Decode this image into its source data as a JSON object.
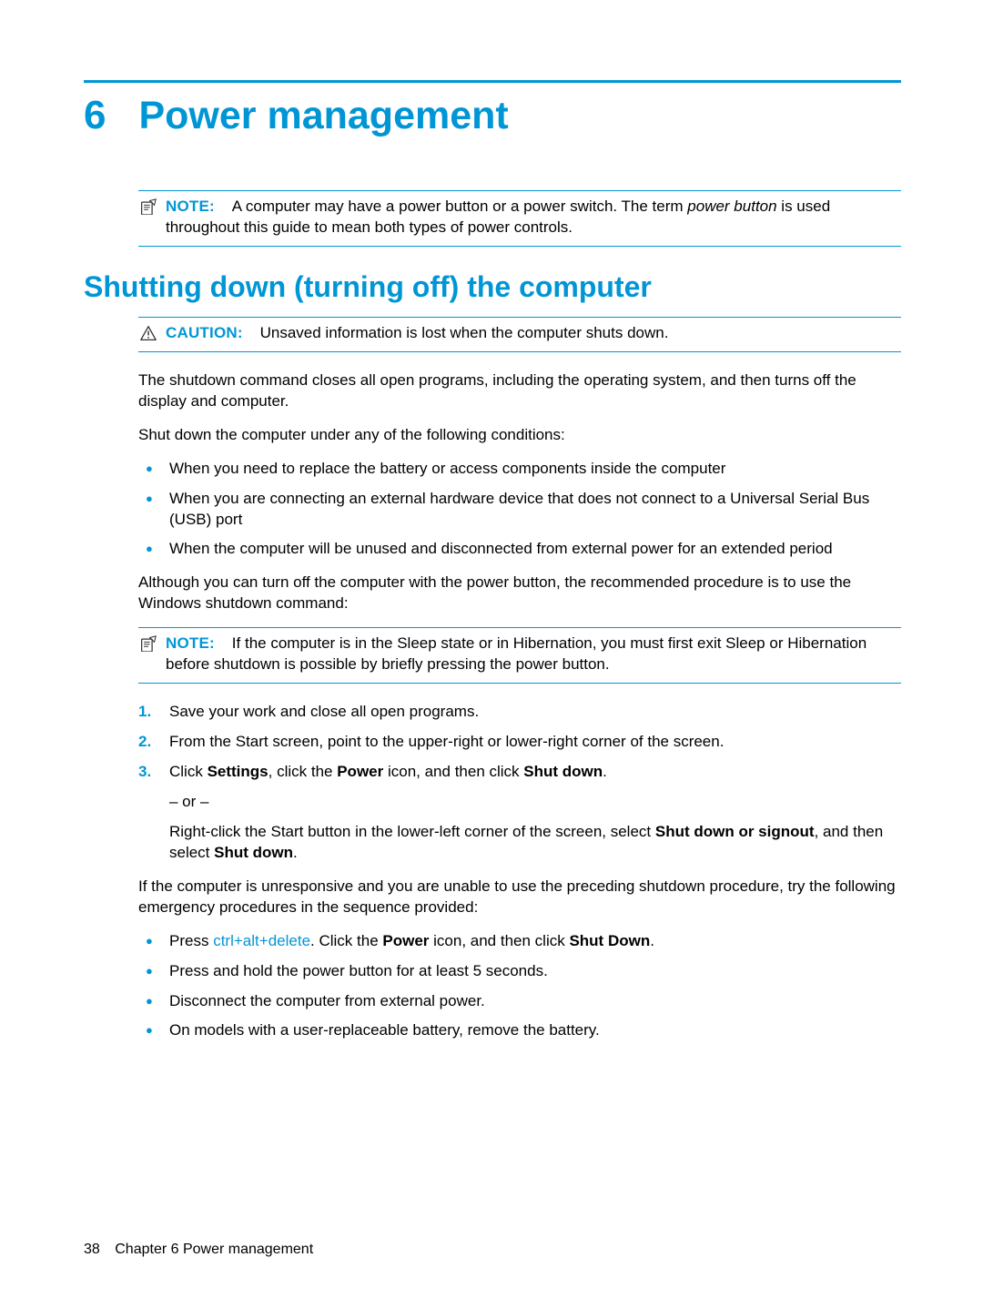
{
  "chapter": {
    "number": "6",
    "title": "Power management"
  },
  "note1": {
    "label": "NOTE:",
    "text_pre": "A computer may have a power button or a power switch. The term ",
    "text_em": "power button",
    "text_post": " is used throughout this guide to mean both types of power controls."
  },
  "section": {
    "title": "Shutting down (turning off) the computer"
  },
  "caution": {
    "label": "CAUTION:",
    "text": "Unsaved information is lost when the computer shuts down."
  },
  "para1": "The shutdown command closes all open programs, including the operating system, and then turns off the display and computer.",
  "para2": "Shut down the computer under any of the following conditions:",
  "conditions": [
    "When you need to replace the battery or access components inside the computer",
    "When you are connecting an external hardware device that does not connect to a Universal Serial Bus (USB) port",
    "When the computer will be unused and disconnected from external power for an extended period"
  ],
  "para3": "Although you can turn off the computer with the power button, the recommended procedure is to use the Windows shutdown command:",
  "note2": {
    "label": "NOTE:",
    "text": "If the computer is in the Sleep state or in Hibernation, you must first exit Sleep or Hibernation before shutdown is possible by briefly pressing the power button."
  },
  "steps": {
    "s1": "Save your work and close all open programs.",
    "s2": "From the Start screen, point to the upper-right or lower-right corner of the screen.",
    "s3_pre": "Click ",
    "s3_b1": "Settings",
    "s3_mid1": ", click the ",
    "s3_b2": "Power",
    "s3_mid2": " icon, and then click ",
    "s3_b3": "Shut down",
    "s3_post": ".",
    "or": "– or –",
    "s3b_pre": "Right-click the Start button in the lower-left corner of the screen, select ",
    "s3b_b1": "Shut down or signout",
    "s3b_mid": ", and then select ",
    "s3b_b2": "Shut down",
    "s3b_post": "."
  },
  "para4": "If the computer is unresponsive and you are unable to use the preceding shutdown procedure, try the following emergency procedures in the sequence provided:",
  "emergency": {
    "e1_pre": "Press ",
    "e1_k1": "ctrl",
    "e1_plus": "+",
    "e1_k2": "alt",
    "e1_k3": "delete",
    "e1_mid": ". Click the ",
    "e1_b1": "Power",
    "e1_mid2": " icon, and then click ",
    "e1_b2": "Shut Down",
    "e1_post": ".",
    "e2": "Press and hold the power button for at least 5 seconds.",
    "e3": "Disconnect the computer from external power.",
    "e4": "On models with a user-replaceable battery, remove the battery."
  },
  "footer": {
    "page": "38",
    "text": "Chapter 6   Power management"
  }
}
